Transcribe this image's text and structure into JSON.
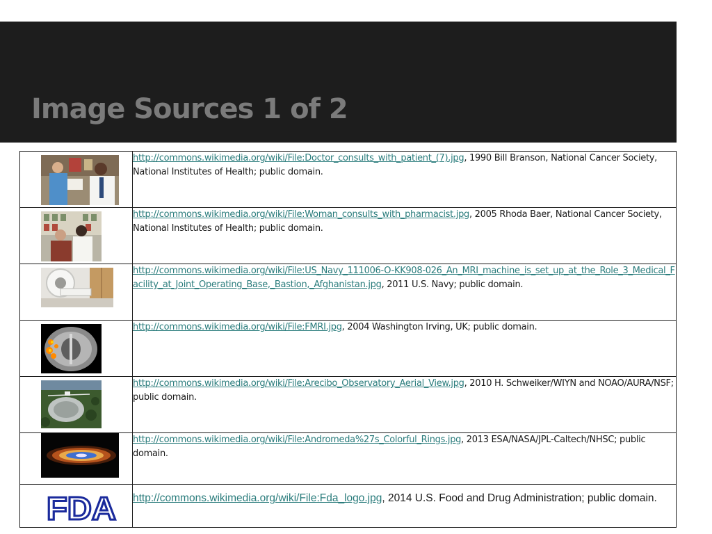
{
  "slide": {
    "title": "Image Sources 1 of 2"
  },
  "rows": [
    {
      "link": "http://commons.wikimedia.org/wiki/File:Doctor_consults_with_patient_(7).jpg",
      "credit": ", 1990 Bill Branson, National Cancer Society, National Institutes of Health; public domain.",
      "image": "doctor-consults-patient-photo"
    },
    {
      "link": "http://commons.wikimedia.org/wiki/File:Woman_consults_with_pharmacist.jpg",
      "credit": ", 2005 Rhoda Baer, National Cancer Society, National Institutes of Health; public domain.",
      "image": "woman-pharmacist-photo"
    },
    {
      "link": "http://commons.wikimedia.org/wiki/File:US_Navy_111006-O-KK908-026_An_MRI_machine_is_set_up_at_the_Role_3_Medical_Facility_at_Joint_Operating_Base,_Bastion,_Afghanistan.jpg",
      "credit": ", 2011 U.S. Navy; public domain.",
      "image": "mri-machine-photo"
    },
    {
      "link": "http://commons.wikimedia.org/wiki/File:FMRI.jpg",
      "credit": ", 2004 Washington Irving, UK; public domain.",
      "image": "fmri-scan-image"
    },
    {
      "link": "http://commons.wikimedia.org/wiki/File:Arecibo_Observatory_Aerial_View.jpg",
      "credit": ", 2010 H. Schweiker/WIYN and NOAO/AURA/NSF; public domain.",
      "image": "arecibo-observatory-photo"
    },
    {
      "link": "http://commons.wikimedia.org/wiki/File:Andromeda%27s_Colorful_Rings.jpg",
      "credit": ", 2013 ESA/NASA/JPL-Caltech/NHSC; public domain.",
      "image": "andromeda-rings-image"
    },
    {
      "link": "http://commons.wikimedia.org/wiki/File:Fda_logo.jpg",
      "credit": ", 2014 U.S. Food and Drug Administration; public domain.",
      "image": "fda-logo",
      "logo_text": "FDA"
    }
  ],
  "colors": {
    "header_bg": "#1d1d1d",
    "title": "#7b7b7b",
    "link": "#2a7c7c",
    "fda_blue": "#1a2a9c"
  }
}
